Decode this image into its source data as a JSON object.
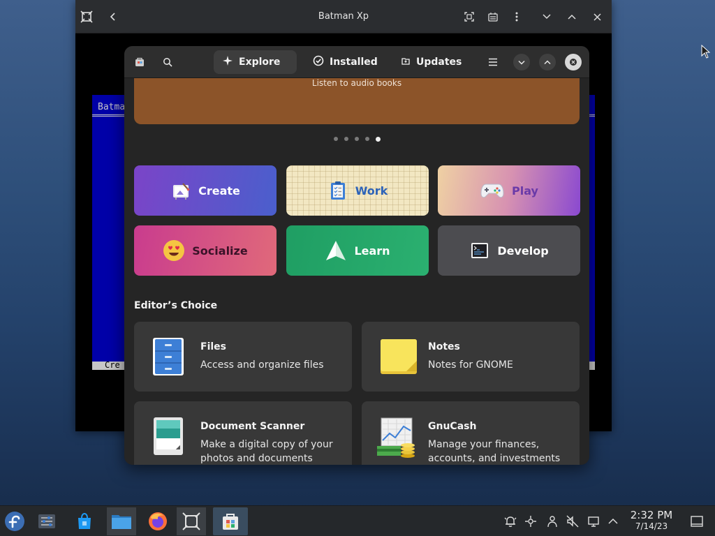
{
  "background_window": {
    "title": "Batman Xp",
    "dos_title": "Batma",
    "dos_bottom": "Cre"
  },
  "software": {
    "tabs": [
      {
        "label": "Explore"
      },
      {
        "label": "Installed"
      },
      {
        "label": "Updates"
      }
    ],
    "banner_text": "Listen to audio books",
    "carousel": {
      "count": 5,
      "active": 5
    },
    "categories": [
      {
        "label": "Create"
      },
      {
        "label": "Work"
      },
      {
        "label": "Play"
      },
      {
        "label": "Socialize"
      },
      {
        "label": "Learn"
      },
      {
        "label": "Develop"
      }
    ],
    "editors_choice": {
      "title": "Editor’s Choice",
      "apps": [
        {
          "name": "Files",
          "description": "Access and organize files"
        },
        {
          "name": "Notes",
          "description": "Notes for GNOME"
        },
        {
          "name": "Document Scanner",
          "description": "Make a digital copy of your photos and documents"
        },
        {
          "name": "GnuCash",
          "description": "Manage your finances, accounts, and investments"
        }
      ]
    }
  },
  "taskbar": {
    "clock_time": "2:32 PM",
    "clock_date": "7/14/23"
  },
  "colors": {
    "banner": "#8c5429",
    "window_bg": "#252525",
    "taskbar": "#25282b",
    "active_task": "#3a4d60"
  }
}
